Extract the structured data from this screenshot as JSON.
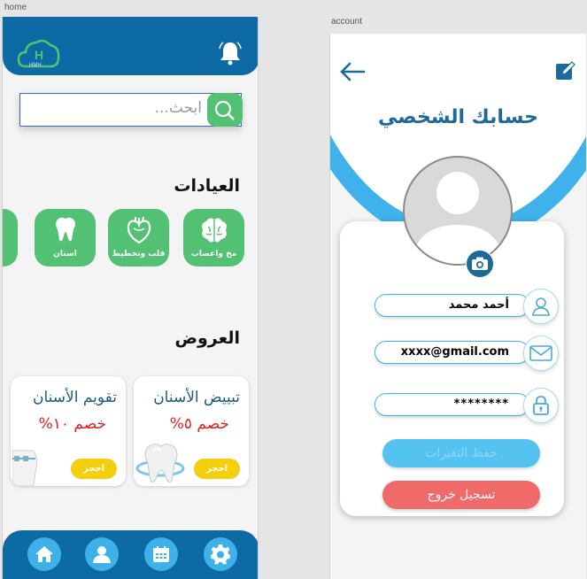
{
  "artboards": {
    "home": "home",
    "account": "account"
  },
  "home": {
    "logo_text": "HMH",
    "logo_letter": "H",
    "search": {
      "placeholder": "ابحث..."
    },
    "clinics_title": "العيادات",
    "clinics": [
      {
        "label": "مخ واعصاب",
        "icon": "brain-icon"
      },
      {
        "label": "قلب وتخطيط",
        "icon": "heart-icon"
      },
      {
        "label": "اسنان",
        "icon": "tooth-icon"
      }
    ],
    "offers_title": "العروض",
    "offers": [
      {
        "title": "تبييض الأسنان",
        "discount": "خصم ٥%",
        "button": "احجز"
      },
      {
        "title": "تقويم الأسنان",
        "discount": "خصم ١٠%",
        "button": "احجز"
      }
    ],
    "nav": [
      {
        "icon": "home-icon"
      },
      {
        "icon": "user-icon"
      },
      {
        "icon": "calendar-icon"
      },
      {
        "icon": "gear-icon"
      }
    ],
    "colors": {
      "primary": "#0e6aa5",
      "accent": "#52c173",
      "nav_button": "#3eb0ea",
      "book": "#f4cf0c"
    }
  },
  "account": {
    "title": "حسابك الشخصي",
    "name": "أحمد محمد",
    "email": "xxxx@gmail.com",
    "password": "********",
    "save_label": "حفظ التغيرات",
    "logout_label": "تسجيل خروج",
    "colors": {
      "arc": "#3fb2ec",
      "save": "#54c3f2",
      "logout": "#f06a6a"
    }
  }
}
